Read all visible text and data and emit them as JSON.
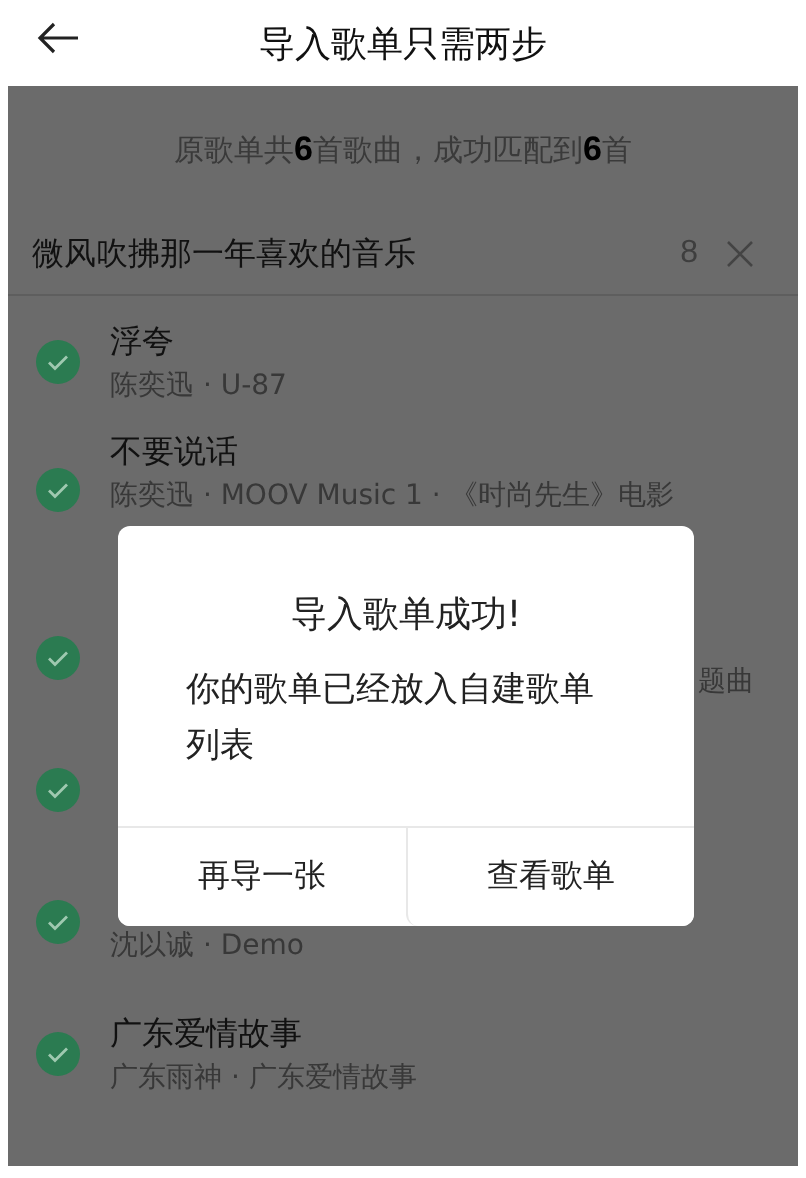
{
  "header": {
    "title": "导入歌单只需两步"
  },
  "summary": "原歌单共**6**首歌曲，成功匹配到**6**首",
  "playlist": {
    "name": "微风吹拂那一年喜欢的音乐",
    "count": "8"
  },
  "songs": [
    {
      "title": "浮夸",
      "subtitle": "陈奕迅 · U-87",
      "checked": true
    },
    {
      "title": "不要说话",
      "subtitle": "陈奕迅 · MOOV Music 1 · 《时尚先生》电影",
      "checked": true,
      "wrapped": true
    },
    {
      "subtitle_end": "题曲",
      "checked": true
    },
    {
      "checked": true
    },
    {
      "subtitle": "沈以诚 · Demo",
      "checked": true
    },
    {
      "title": "广东爱情故事",
      "subtitle": "广东雨神 · 广东爱情故事",
      "checked": true
    }
  ],
  "dialog": {
    "title": "导入歌单成功!",
    "message": "你的歌单已经放入自建歌单列表",
    "buttons": [
      "再导一张",
      "查看歌单"
    ]
  }
}
